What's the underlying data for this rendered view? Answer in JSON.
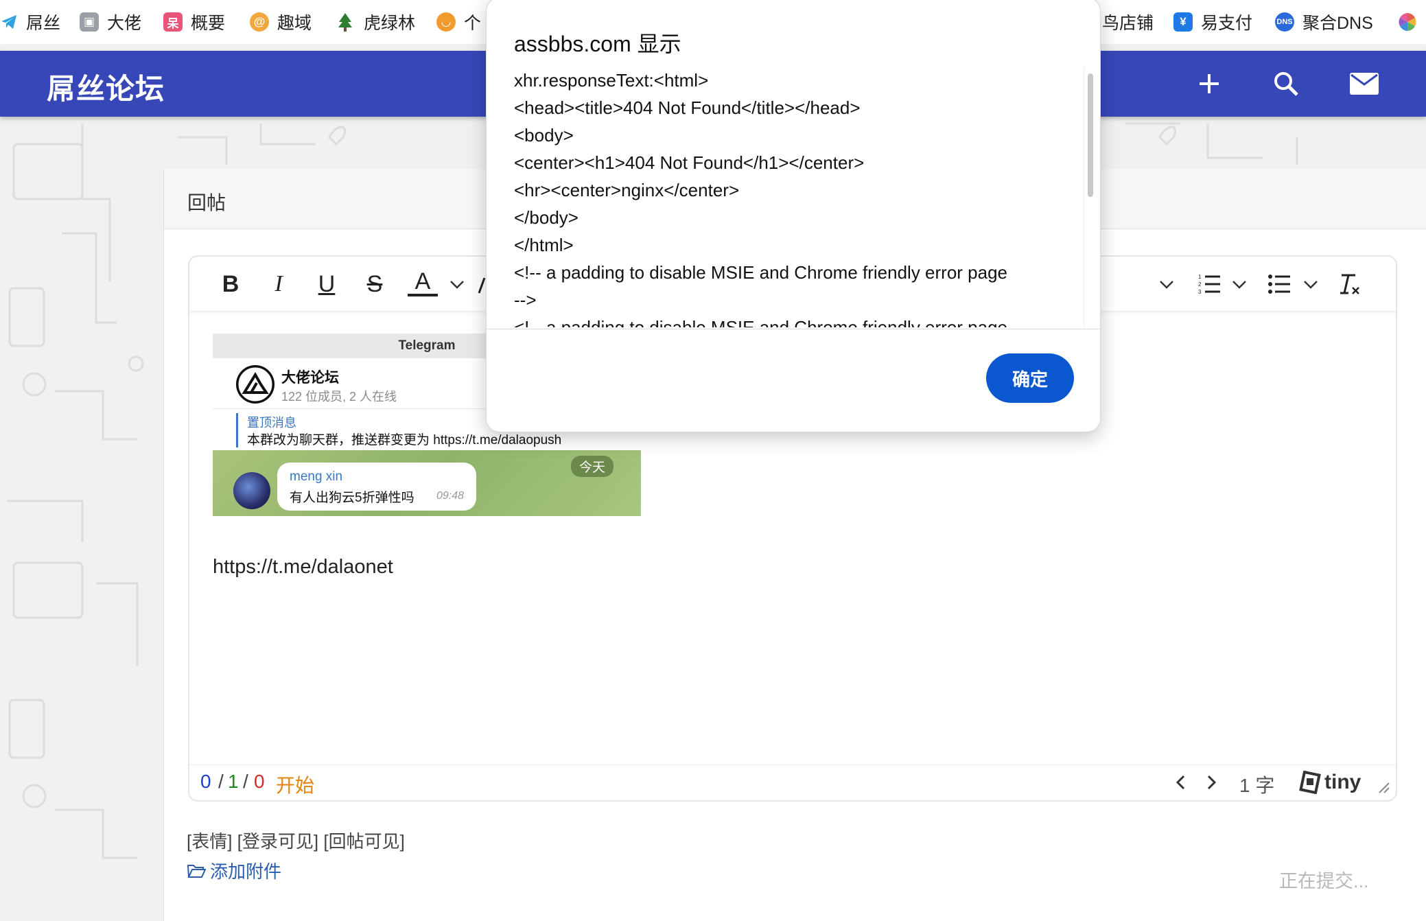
{
  "bookmarks": [
    {
      "label": "屌丝",
      "icon": "telegram-icon",
      "color": "#2aa3e0"
    },
    {
      "label": "大佬",
      "icon": "box-icon",
      "color": "#8a8a8a"
    },
    {
      "label": "概要",
      "icon": "note-icon",
      "color": "#e8557a"
    },
    {
      "label": "趣域",
      "icon": "globe-icon",
      "color": "#f2a73b"
    },
    {
      "label": "虎绿林",
      "icon": "tree-icon",
      "color": "#2e7d32"
    },
    {
      "label": "个",
      "icon": "circle-icon",
      "color": "#f39a2e"
    },
    {
      "label": "鸟店铺",
      "icon": "",
      "color": ""
    },
    {
      "label": "易支付",
      "icon": "payment-shield-icon",
      "color": "#1e78e6"
    },
    {
      "label": "聚合DNS",
      "icon": "dns-icon",
      "color": "#2a6ad8"
    },
    {
      "label": "",
      "icon": "pinwheel-icon",
      "color": "#e0604c"
    }
  ],
  "header": {
    "logo": "屌丝论坛",
    "color": "#3747b8",
    "actions": [
      "plus-icon",
      "search-icon",
      "mail-icon"
    ]
  },
  "card": {
    "title": "回帖"
  },
  "editor": {
    "toolbar": [
      "bold",
      "italic",
      "underline",
      "strikethrough",
      "text-color",
      "numbered-list",
      "bullet-list",
      "clear-formatting"
    ],
    "embed": {
      "top_label": "Telegram",
      "group_name": "大佬论坛",
      "group_meta": "122 位成员, 2 人在线",
      "pinned_title": "置顶消息",
      "pinned_text": "本群改为聊天群，推送群变更为 https://t.me/dalaopush",
      "day_label": "今天",
      "sender": "meng xin",
      "message": "有人出狗云5折弹性吗",
      "time": "09:48"
    },
    "link_text": "https://t.me/dalaonet",
    "status": {
      "count_a": "0",
      "sep1": "/",
      "count_b": "1",
      "sep2": "/",
      "count_c": "0",
      "start_label": "开始",
      "word_count": "1 字",
      "brand": "tiny"
    }
  },
  "below_editor": {
    "tags": "[表情] [登录可见] [回帖可见]",
    "attach_label": "添加附件",
    "submitting": "正在提交..."
  },
  "dialog": {
    "title": "assbbs.com 显示",
    "lines": [
      "xhr.responseText:<html>",
      "<head><title>404 Not Found</title></head>",
      "<body>",
      "<center><h1>404 Not Found</h1></center>",
      "<hr><center>nginx</center>",
      "</body>",
      "</html>",
      "<!-- a padding to disable MSIE and Chrome friendly error page",
      "-->",
      "<!-- a padding to disable MSIE and Chrome friendly error page"
    ],
    "ok_label": "确定",
    "ok_color": "#0b57d0"
  }
}
